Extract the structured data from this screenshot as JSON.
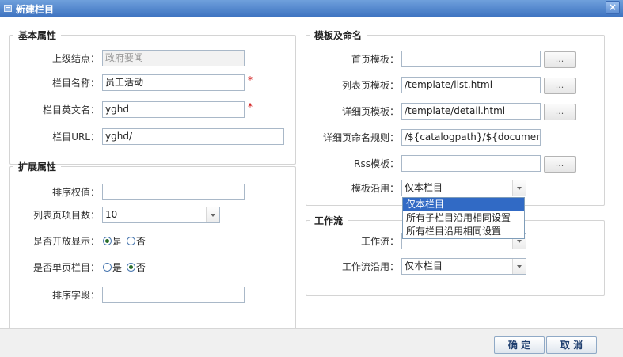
{
  "window": {
    "title": "新建栏目",
    "close_label": "×"
  },
  "basic": {
    "legend": "基本属性",
    "parent": {
      "label": "上级结点：",
      "value": "政府要闻"
    },
    "name": {
      "label": "栏目名称：",
      "value": "员工活动",
      "required": "*"
    },
    "english": {
      "label": "栏目英文名：",
      "value": "yghd",
      "required": "*"
    },
    "url": {
      "label": "栏目URL：",
      "value": "yghd/"
    }
  },
  "extended": {
    "legend": "扩展属性",
    "order_weight": {
      "label": "排序权值：",
      "value": ""
    },
    "page_size": {
      "label": "列表页项目数：",
      "value": "10"
    },
    "open_display": {
      "label": "是否开放显示：",
      "yes": "是",
      "no": "否",
      "selected": "yes"
    },
    "single_page": {
      "label": "是否单页栏目：",
      "yes": "是",
      "no": "否",
      "selected": "no"
    },
    "sort_field": {
      "label": "排序字段：",
      "value": ""
    }
  },
  "template": {
    "legend": "模板及命名",
    "browse_label": "...",
    "home": {
      "label": "首页模板：",
      "value": ""
    },
    "list": {
      "label": "列表页模板：",
      "value": "/template/list.html"
    },
    "detail": {
      "label": "详细页模板：",
      "value": "/template/detail.html"
    },
    "naming": {
      "label": "详细页命名规则：",
      "value": "/${catalogpath}/${document.id}"
    },
    "rss": {
      "label": "Rss模板：",
      "value": ""
    },
    "inherit": {
      "label": "模板沿用：",
      "value": "仅本栏目"
    },
    "inherit_options": [
      "仅本栏目",
      "所有子栏目沿用相同设置",
      "所有栏目沿用相同设置"
    ]
  },
  "workflow": {
    "legend": "工作流",
    "flow": {
      "label": "工作流：",
      "value": ""
    },
    "inherit": {
      "label": "工作流沿用：",
      "value": "仅本栏目"
    }
  },
  "footer": {
    "ok_label": "确 定",
    "cancel_label": "取 消"
  }
}
